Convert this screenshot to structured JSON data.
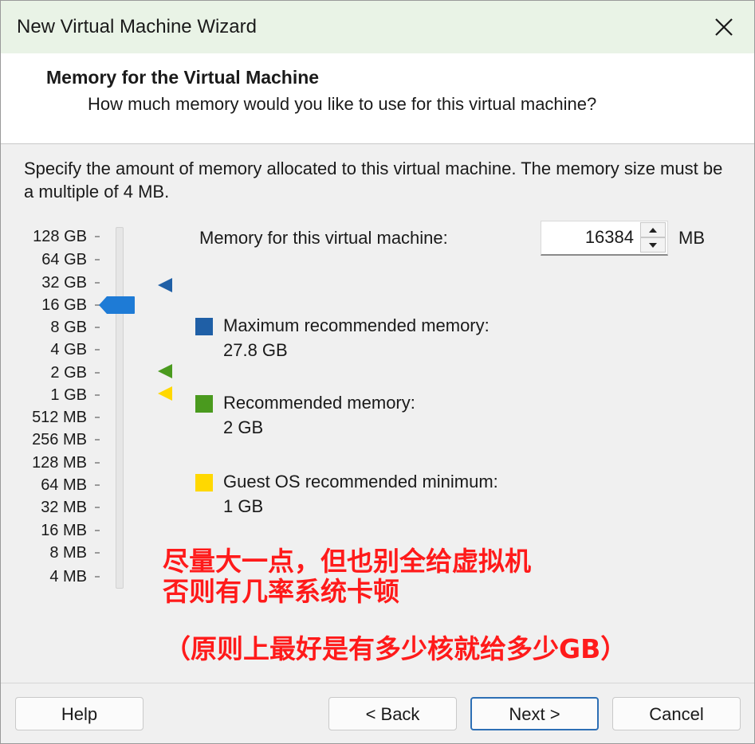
{
  "window": {
    "title": "New Virtual Machine Wizard",
    "close_icon": "close-icon"
  },
  "header": {
    "title": "Memory for the Virtual Machine",
    "subtitle": "How much memory would you like to use for this virtual machine?"
  },
  "description": "Specify the amount of memory allocated to this virtual machine. The memory size must be a multiple of 4 MB.",
  "scale": {
    "labels": [
      "128 GB",
      "64 GB",
      "32 GB",
      "16 GB",
      "8 GB",
      "4 GB",
      "2 GB",
      "1 GB",
      "512 MB",
      "256 MB",
      "128 MB",
      "64 MB",
      "32 MB",
      "16 MB",
      "8 MB",
      "4 MB"
    ],
    "selected_label": "16 GB"
  },
  "memory": {
    "label": "Memory for this virtual machine:",
    "value": "16384",
    "unit": "MB"
  },
  "legend": {
    "max": {
      "label": "Maximum recommended memory:",
      "value": "27.8 GB",
      "color": "#1f5fa6",
      "marker_at": "32 GB"
    },
    "recommended": {
      "label": "Recommended memory:",
      "value": "2 GB",
      "color": "#4a9a1e",
      "marker_at": "2 GB"
    },
    "minimum": {
      "label": "Guest OS recommended minimum:",
      "value": "1 GB",
      "color": "#ffd800",
      "marker_at": "1 GB"
    }
  },
  "slider_color": "#1e7bd6",
  "annotation": {
    "line1": "尽量大一点，但也别全给虚拟机",
    "line2": "否则有几率系统卡顿",
    "line3": "（原则上最好是有多少核就给多少GB）"
  },
  "buttons": {
    "help": "Help",
    "back": "< Back",
    "next": "Next >",
    "cancel": "Cancel"
  }
}
